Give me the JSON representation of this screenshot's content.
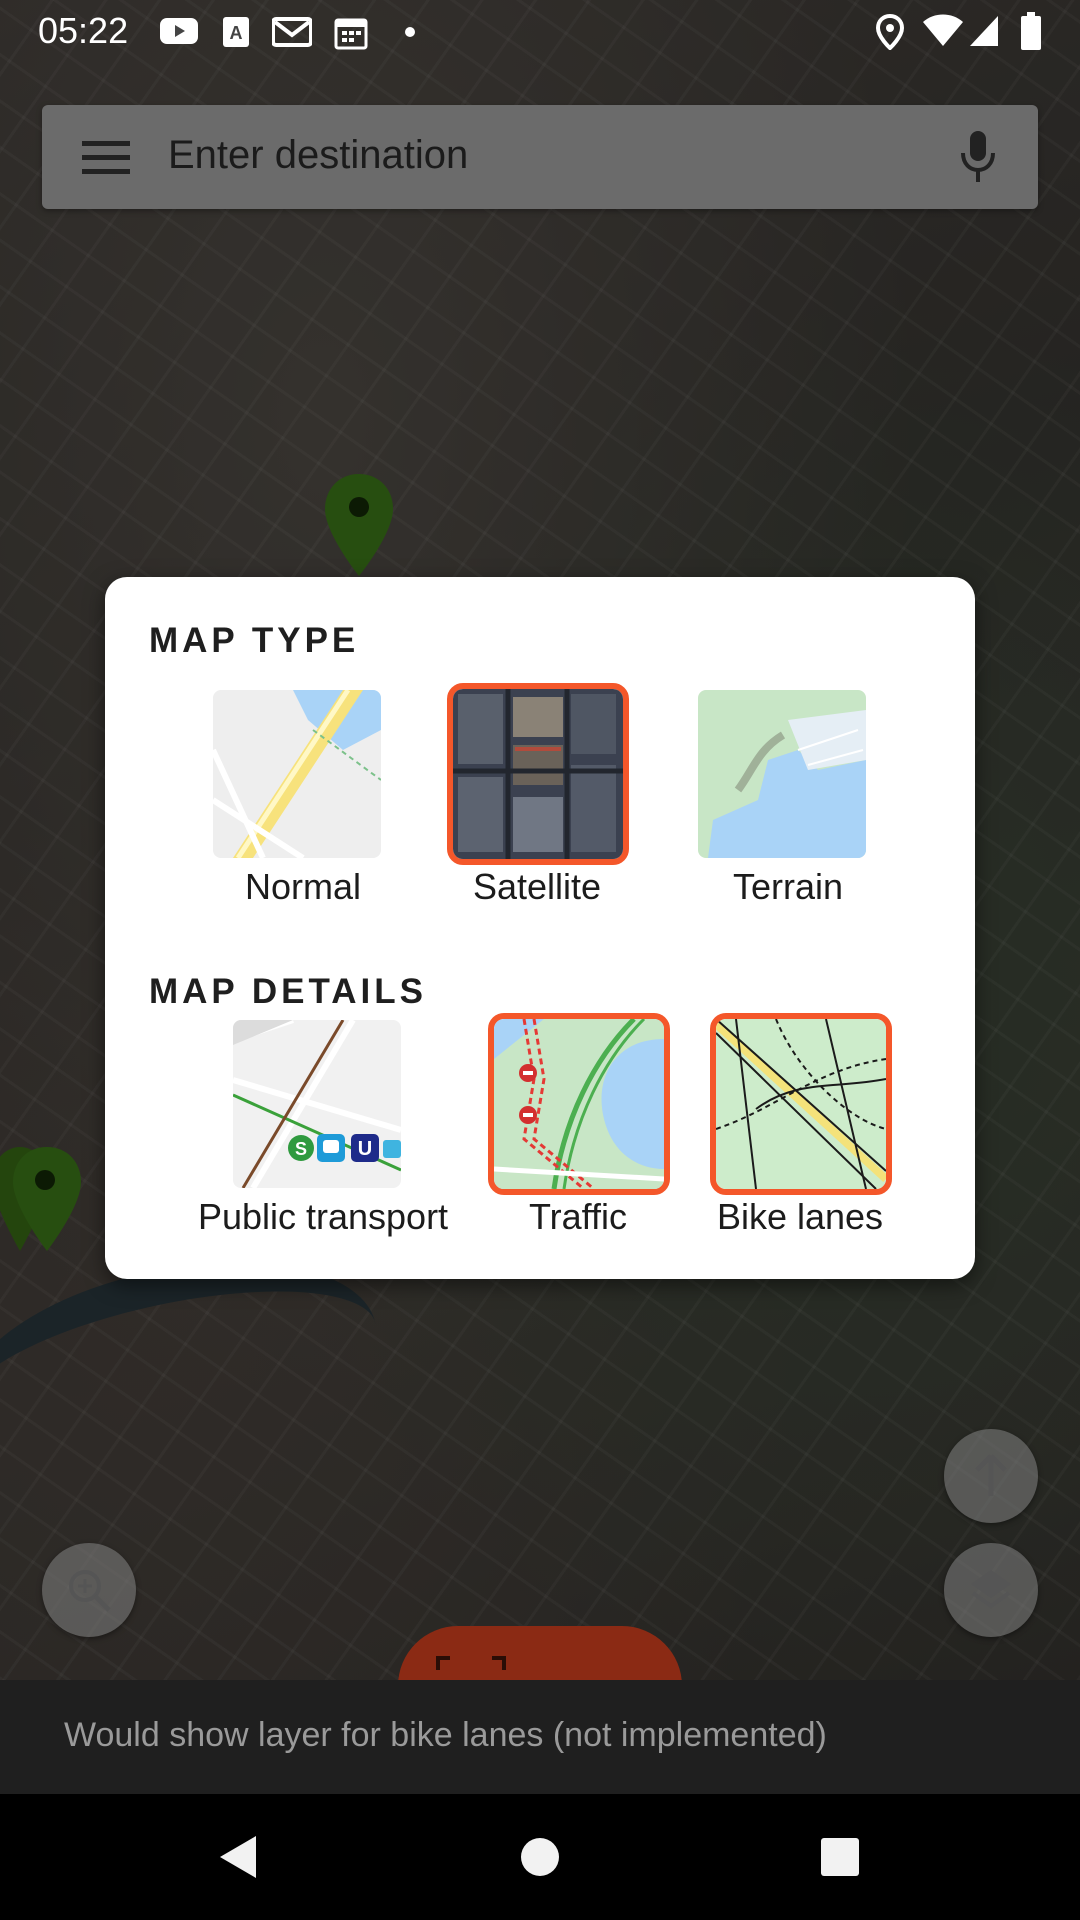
{
  "status_bar": {
    "time": "05:22",
    "icons": [
      "youtube-icon",
      "font-app-icon",
      "gmail-icon",
      "calendar-icon",
      "dot-icon",
      "location-icon",
      "wifi-icon",
      "signal-icon",
      "battery-icon"
    ]
  },
  "search": {
    "placeholder": "Enter destination"
  },
  "dialog": {
    "map_type_title": "MAP TYPE",
    "map_types": [
      {
        "label": "Normal",
        "selected": false
      },
      {
        "label": "Satellite",
        "selected": true
      },
      {
        "label": "Terrain",
        "selected": false
      }
    ],
    "map_details_title": "MAP DETAILS",
    "map_details": [
      {
        "label": "Public transport",
        "selected": false
      },
      {
        "label": "Traffic",
        "selected": true
      },
      {
        "label": "Bike lanes",
        "selected": true
      }
    ]
  },
  "snackbar": {
    "message": "Would show layer for bike lanes (not implemented)"
  },
  "colors": {
    "accent_selected": "#f4572a",
    "marker_green": "#3f7f1a",
    "orange_fab": "#8b2a14"
  }
}
